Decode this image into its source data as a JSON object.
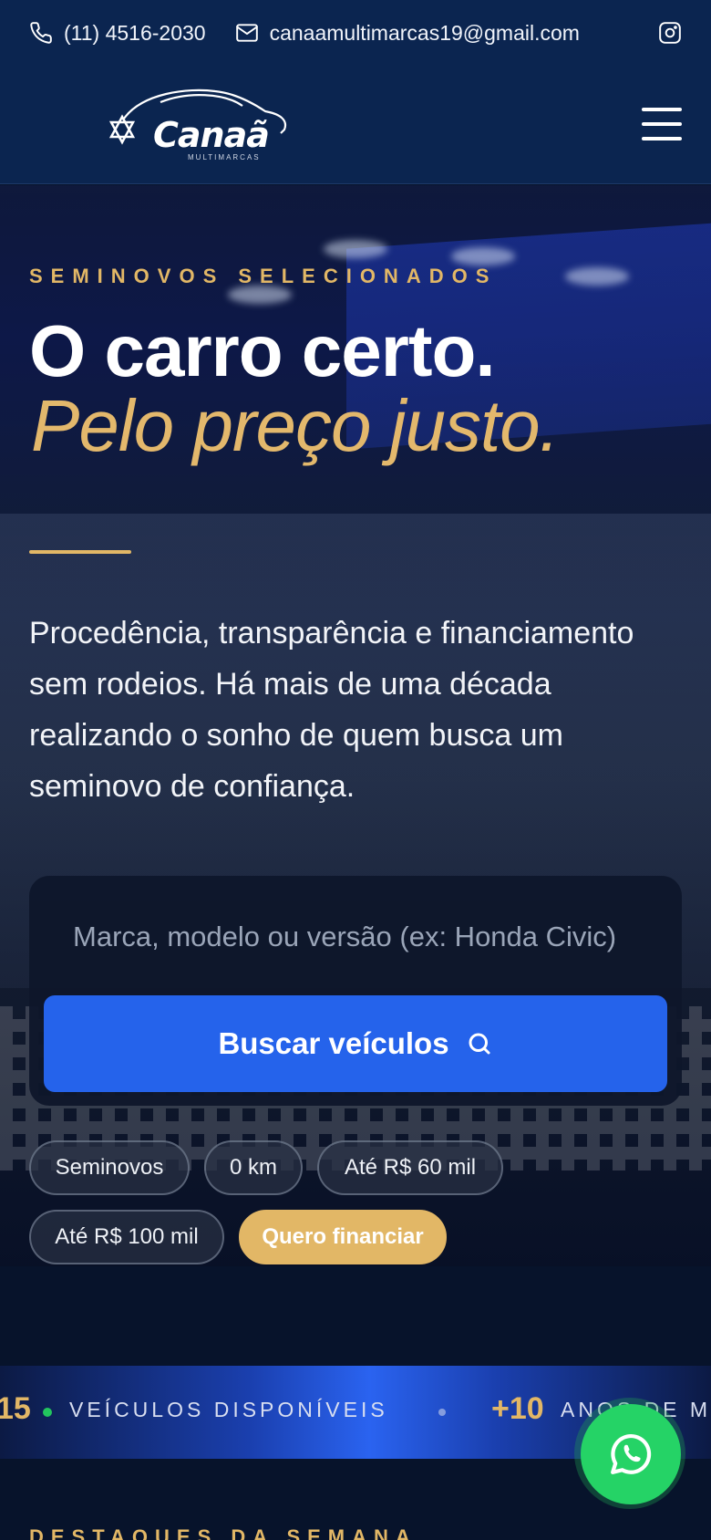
{
  "topbar": {
    "phone": "(11) 4516-2030",
    "email": "canaamultimarcas19@gmail.com"
  },
  "header": {
    "logo_text": "Canaã",
    "logo_subtitle": "MULTIMARCAS"
  },
  "hero": {
    "eyebrow": "SEMINOVOS SELECIONADOS",
    "headline": "O carro certo.",
    "headline_accent": "Pelo preço justo.",
    "lead": "Procedência, transparência e financiamento sem rodeios. Há mais de uma década realizando o sonho de quem busca um seminovo de confiança.",
    "search_placeholder": "Marca, modelo ou versão (ex: Honda Civic)",
    "search_button": "Buscar veículos",
    "chips": [
      "Seminovos",
      "0 km",
      "Até R$ 60 mil",
      "Até R$ 100 mil",
      "Quero financiar"
    ]
  },
  "stats": [
    {
      "value": "15",
      "label": "VEÍCULOS DISPONÍVEIS"
    },
    {
      "value": "+10",
      "label": "ANOS DE M"
    }
  ],
  "next_section": {
    "title": "DESTAQUES DA SEMANA"
  },
  "colors": {
    "navy": "#0b2550",
    "gold": "#e2b766",
    "primary_blue": "#2563eb",
    "whatsapp_green": "#25d366",
    "status_dot_green": "#22c55e"
  }
}
